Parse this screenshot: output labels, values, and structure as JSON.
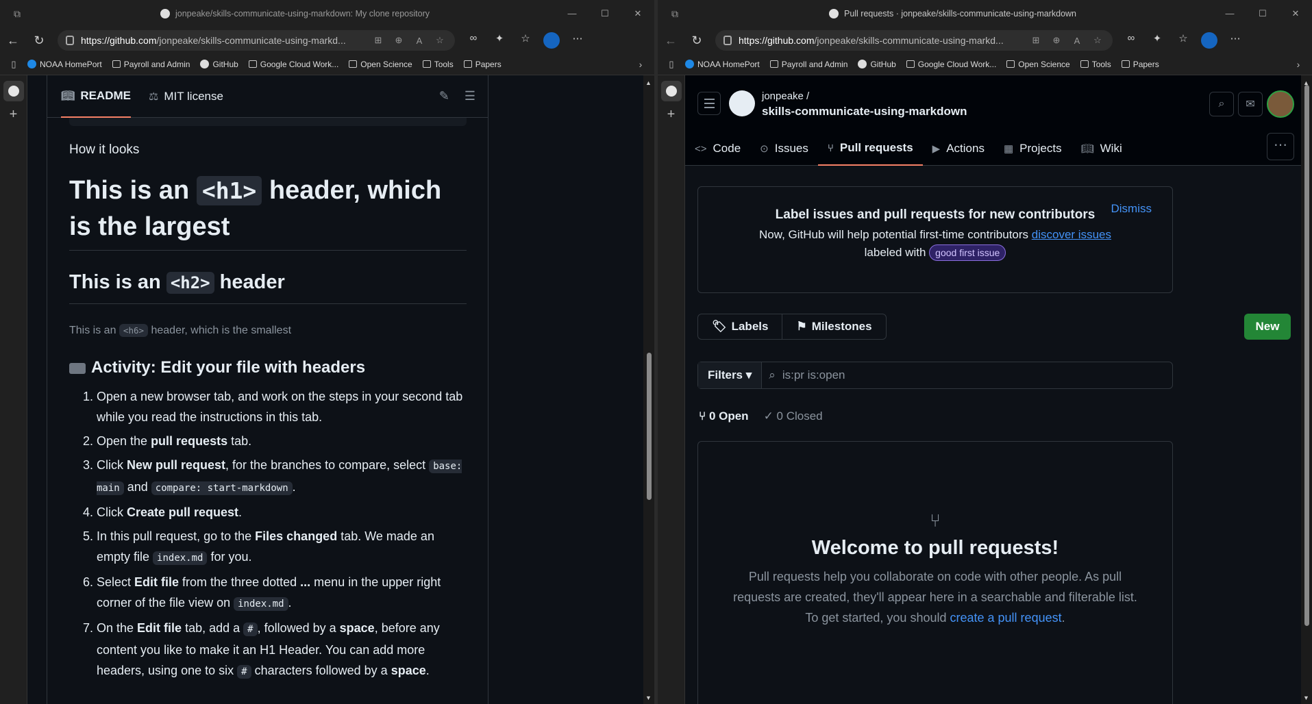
{
  "left": {
    "title": "jonpeake/skills-communicate-using-markdown: My clone repository",
    "url_host": "https://github.com",
    "url_path": "/jonpeake/skills-communicate-using-markd...",
    "tabs": [
      "README",
      "MIT license"
    ],
    "how_it_looks": "How it looks",
    "h1": {
      "pre": "This is an ",
      "code": "<h1>",
      "post": " header, which is the largest"
    },
    "h2": {
      "pre": "This is an ",
      "code": "<h2>",
      "post": " header"
    },
    "h6": {
      "pre": "This is an ",
      "code": "<h6>",
      "post": " header, which is the smallest"
    },
    "activity": "Activity: Edit your file with headers",
    "steps": {
      "s1": "Open a new browser tab, and work on the steps in your second tab while you read the instructions in this tab.",
      "s2a": "Open the ",
      "s2b": "pull requests",
      "s2c": " tab.",
      "s3a": "Click ",
      "s3b": "New pull request",
      "s3c": ", for the branches to compare, select ",
      "s3d": "base: main",
      "s3e": " and ",
      "s3f": "compare: start-markdown",
      "s3g": ".",
      "s4a": "Click ",
      "s4b": "Create pull request",
      "s4c": ".",
      "s5a": "In this pull request, go to the ",
      "s5b": "Files changed",
      "s5c": " tab. We made an empty file ",
      "s5d": "index.md",
      "s5e": " for you.",
      "s6a": "Select ",
      "s6b": "Edit file",
      "s6c": " from the three dotted ",
      "s6d": "...",
      "s6e": " menu in the upper right corner of the file view on ",
      "s6f": "index.md",
      "s6g": ".",
      "s7a": "On the ",
      "s7b": "Edit file",
      "s7c": " tab, add a ",
      "s7d": "#",
      "s7e": ", followed by a ",
      "s7f": "space",
      "s7g": ", before any content you like to make it an H1 Header. You can add more headers, using one to six ",
      "s7h": "#",
      "s7i": " characters followed by a ",
      "s7j": "space",
      "s7k": "."
    }
  },
  "right": {
    "title": "Pull requests · jonpeake/skills-communicate-using-markdown",
    "url_host": "https://github.com",
    "url_path": "/jonpeake/skills-communicate-using-markd...",
    "owner": "jonpeake /",
    "repo": "skills-communicate-using-markdown",
    "nav": [
      "Code",
      "Issues",
      "Pull requests",
      "Actions",
      "Projects",
      "Wiki"
    ],
    "banner": {
      "title": "Label issues and pull requests for new contributors",
      "text1": "Now, GitHub will help potential first-time contributors ",
      "link": "discover issues",
      "text2": "labeled with ",
      "label": "good first issue",
      "dismiss": "Dismiss"
    },
    "labels": "Labels",
    "milestones": "Milestones",
    "new": "New",
    "filters": "Filters",
    "search": "is:pr is:open",
    "open": "0 Open",
    "closed": "0 Closed",
    "welcome_title": "Welcome to pull requests!",
    "welcome_text": "Pull requests help you collaborate on code with other people. As pull requests are created, they'll appear here in a searchable and filterable list. To get started, you should ",
    "welcome_link": "create a pull request",
    "welcome_end": "."
  },
  "favorites": [
    "NOAA HomePort",
    "Payroll and Admin",
    "GitHub",
    "Google Cloud Work...",
    "Open Science",
    "Tools",
    "Papers"
  ],
  "colors": {
    "accent": "#f78166",
    "link": "#4493f8",
    "green": "#238636"
  }
}
